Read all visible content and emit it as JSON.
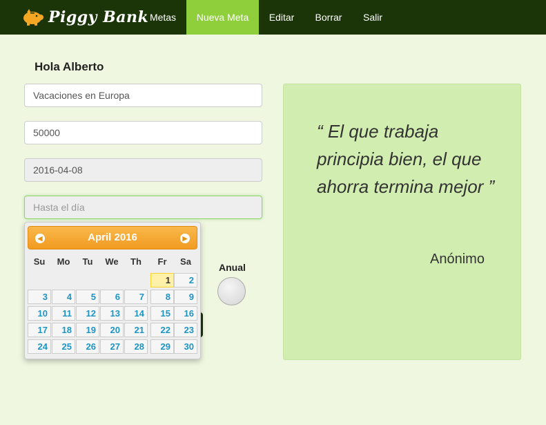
{
  "brand": {
    "name": "Piggy Bank",
    "logo_icon": "piggy-bank-icon",
    "logo_color": "#f5a623"
  },
  "nav": {
    "items": [
      {
        "label": "Metas"
      },
      {
        "label": "Nueva Meta",
        "active": true
      },
      {
        "label": "Editar"
      },
      {
        "label": "Borrar"
      },
      {
        "label": "Salir"
      }
    ]
  },
  "greeting": "Hola Alberto",
  "form": {
    "goal_name": "Vacaciones en Europa",
    "amount": "50000",
    "start_date": "2016-04-08",
    "end_date_placeholder": "Hasta el día",
    "anual_label": "Anual"
  },
  "datepicker": {
    "month_title": "April 2016",
    "prev_icon": "chevron-left-icon",
    "next_icon": "chevron-right-icon",
    "weekdays": [
      "Su",
      "Mo",
      "Tu",
      "We",
      "Th",
      "Fr",
      "Sa"
    ],
    "first_weekday_index": 5,
    "days": [
      "1",
      "2",
      "3",
      "4",
      "5",
      "6",
      "7",
      "8",
      "9",
      "10",
      "11",
      "12",
      "13",
      "14",
      "15",
      "16",
      "17",
      "18",
      "19",
      "20",
      "21",
      "22",
      "23",
      "24",
      "25",
      "26",
      "27",
      "28",
      "29",
      "30"
    ],
    "highlighted_day": "1"
  },
  "quote": {
    "text": "“ El que trabaja principia bien, el que ahorra termina mejor ”",
    "author": "Anónimo"
  },
  "colors": {
    "navbar": "#1b3508",
    "nav_active": "#8fcf3c",
    "page_bg": "#eff7e1",
    "quote_bg": "#d1edb0",
    "datepicker_header": "#f29b21",
    "day_link": "#1c94c4"
  }
}
